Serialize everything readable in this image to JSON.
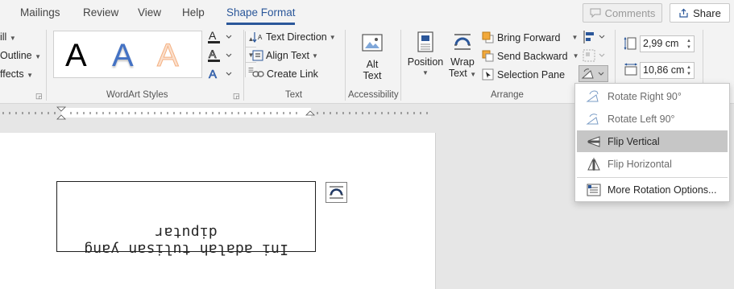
{
  "tabs": [
    {
      "label": "Mailings"
    },
    {
      "label": "Review"
    },
    {
      "label": "View"
    },
    {
      "label": "Help"
    },
    {
      "label": "Shape Format"
    }
  ],
  "top_actions": {
    "comments": "Comments",
    "share": "Share"
  },
  "shape_styles_partial": {
    "fill": "ill",
    "outline": "Outline",
    "effects": "ffects"
  },
  "wordart": {
    "sample_letter": "A",
    "group_label": "WordArt Styles"
  },
  "text_group": {
    "text_direction": "Text Direction",
    "align_text": "Align Text",
    "create_link": "Create Link",
    "group_label": "Text"
  },
  "accessibility": {
    "alt_text_line1": "Alt",
    "alt_text_line2": "Text",
    "group_label": "Accessibility"
  },
  "arrange": {
    "position": "Position",
    "wrap_line1": "Wrap",
    "wrap_line2": "Text",
    "bring_forward": "Bring Forward",
    "send_backward": "Send Backward",
    "selection_pane": "Selection Pane",
    "group_label": "Arrange"
  },
  "size": {
    "height": "2,99 cm",
    "width": "10,86 cm"
  },
  "rotate_menu": {
    "items": [
      {
        "label": "Rotate Right 90°",
        "icon": "rotate-right-icon",
        "dim": true
      },
      {
        "label": "Rotate Left 90°",
        "icon": "rotate-left-icon",
        "dim": true
      },
      {
        "label": "Flip Vertical",
        "icon": "flip-vertical-icon",
        "dim": false
      },
      {
        "label": "Flip Horizontal",
        "icon": "flip-horizontal-icon",
        "dim": true
      }
    ],
    "more": "More Rotation Options..."
  },
  "document": {
    "textbox_text": "Ini adalah tulisan yang diputar"
  },
  "colors": {
    "accent": "#2b579a",
    "wordart_blue": "#4472c4",
    "wordart_orange": "#f4b183",
    "highlight": "#c6c6c6"
  }
}
